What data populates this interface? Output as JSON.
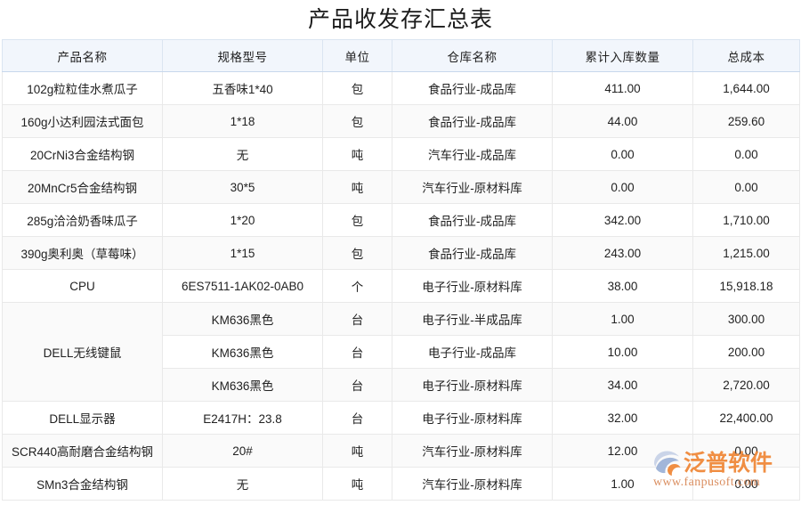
{
  "page": {
    "title": "产品收发存汇总表"
  },
  "table": {
    "columns": [
      {
        "key": "product_name",
        "label": "产品名称"
      },
      {
        "key": "spec_model",
        "label": "规格型号"
      },
      {
        "key": "unit",
        "label": "单位"
      },
      {
        "key": "warehouse",
        "label": "仓库名称"
      },
      {
        "key": "total_in_qty",
        "label": "累计入库数量"
      },
      {
        "key": "total_cost",
        "label": "总成本"
      }
    ],
    "rows": [
      {
        "product_name": "102g粒粒佳水煮瓜子",
        "spec_model": "五香味1*40",
        "unit": "包",
        "warehouse": "食品行业-成品库",
        "total_in_qty": "411.00",
        "total_cost": "1,644.00"
      },
      {
        "product_name": "160g小达利园法式面包",
        "spec_model": "1*18",
        "unit": "包",
        "warehouse": "食品行业-成品库",
        "total_in_qty": "44.00",
        "total_cost": "259.60"
      },
      {
        "product_name": "20CrNi3合金结构钢",
        "spec_model": "无",
        "unit": "吨",
        "warehouse": "汽车行业-成品库",
        "total_in_qty": "0.00",
        "total_cost": "0.00"
      },
      {
        "product_name": "20MnCr5合金结构钢",
        "spec_model": "30*5",
        "unit": "吨",
        "warehouse": "汽车行业-原材料库",
        "total_in_qty": "0.00",
        "total_cost": "0.00"
      },
      {
        "product_name": "285g洽洽奶香味瓜子",
        "spec_model": "1*20",
        "unit": "包",
        "warehouse": "食品行业-成品库",
        "total_in_qty": "342.00",
        "total_cost": "1,710.00"
      },
      {
        "product_name": "390g奥利奥（草莓味）",
        "spec_model": "1*15",
        "unit": "包",
        "warehouse": "食品行业-成品库",
        "total_in_qty": "243.00",
        "total_cost": "1,215.00"
      },
      {
        "product_name": "CPU",
        "spec_model": "6ES7511-1AK02-0AB0",
        "unit": "个",
        "warehouse": "电子行业-原材料库",
        "total_in_qty": "38.00",
        "total_cost": "15,918.18"
      },
      {
        "product_name": "DELL无线键鼠",
        "name_rowspan": 3,
        "spec_model": "KM636黑色",
        "unit": "台",
        "warehouse": "电子行业-半成品库",
        "total_in_qty": "1.00",
        "total_cost": "300.00"
      },
      {
        "product_name": "",
        "name_hidden": true,
        "spec_model": "KM636黑色",
        "unit": "台",
        "warehouse": "电子行业-成品库",
        "total_in_qty": "10.00",
        "total_cost": "200.00"
      },
      {
        "product_name": "",
        "name_hidden": true,
        "spec_model": "KM636黑色",
        "unit": "台",
        "warehouse": "电子行业-原材料库",
        "total_in_qty": "34.00",
        "total_cost": "2,720.00"
      },
      {
        "product_name": "DELL显示器",
        "spec_model": "E2417H：23.8",
        "unit": "台",
        "warehouse": "电子行业-原材料库",
        "total_in_qty": "32.00",
        "total_cost": "22,400.00"
      },
      {
        "product_name": "SCR440高耐磨合金结构钢",
        "spec_model": "20#",
        "unit": "吨",
        "warehouse": "汽车行业-原材料库",
        "total_in_qty": "12.00",
        "total_cost": "0.00"
      },
      {
        "product_name": "SMn3合金结构钢",
        "spec_model": "无",
        "unit": "吨",
        "warehouse": "汽车行业-原材料库",
        "total_in_qty": "1.00",
        "total_cost": "0.00"
      }
    ]
  },
  "watermark": {
    "brand": "泛普软件",
    "url": "www.fanpusoft.com"
  },
  "colors": {
    "link_blue": "#5a86d8",
    "header_bg": "#f2f6fc",
    "watermark_orange": "#f08a3c"
  }
}
